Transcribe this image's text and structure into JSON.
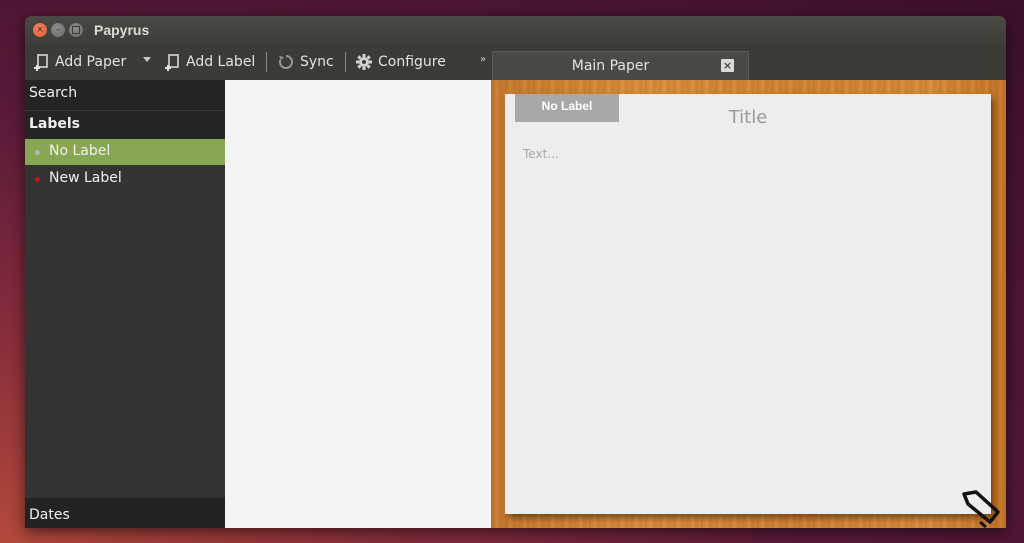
{
  "window": {
    "title": "Papyrus",
    "controls": {
      "close": "×",
      "minimize": "–",
      "maximize": "□"
    }
  },
  "toolbar": {
    "add_paper": "Add Paper",
    "add_label": "Add Label",
    "sync": "Sync",
    "configure": "Configure",
    "overflow": "»"
  },
  "tabs": [
    {
      "label": "Main Paper",
      "close": "×"
    }
  ],
  "sidebar": {
    "search": "Search",
    "labels_header": "Labels",
    "items": [
      {
        "label": "No Label",
        "dot_color": "#b5b5b5",
        "active": true
      },
      {
        "label": "New Label",
        "dot_color": "#c0141c",
        "active": false
      }
    ],
    "dates": "Dates"
  },
  "paper": {
    "label": "No Label",
    "title_placeholder": "Title",
    "text_placeholder": "Text..."
  },
  "colors": {
    "accent": "#87a752",
    "toolbar_bg": "#3c3b37",
    "sidebar_bg": "#333333"
  }
}
